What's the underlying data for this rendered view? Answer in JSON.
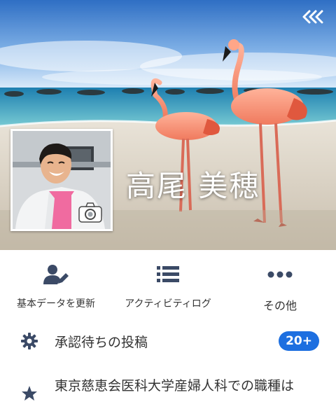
{
  "profile": {
    "name": "高尾 美穂"
  },
  "cover": {
    "description_icons": [
      "collapse-icon",
      "camera-icon"
    ]
  },
  "actions": [
    {
      "label": "基本データを更新",
      "icon": "person-edit-icon"
    },
    {
      "label": "アクティビティログ",
      "icon": "list-icon"
    },
    {
      "label": "その他",
      "icon": "more-dots-icon"
    }
  ],
  "menu": {
    "pending_posts": {
      "label": "承認待ちの投稿",
      "badge": "20+",
      "icon": "gear-icon"
    },
    "work_info": {
      "label": "東京慈恵会医科大学産婦人科での職種は",
      "icon": "star-icon"
    }
  },
  "colors": {
    "accent": "#1d6fe0",
    "icon_dark": "#3b4a66"
  }
}
